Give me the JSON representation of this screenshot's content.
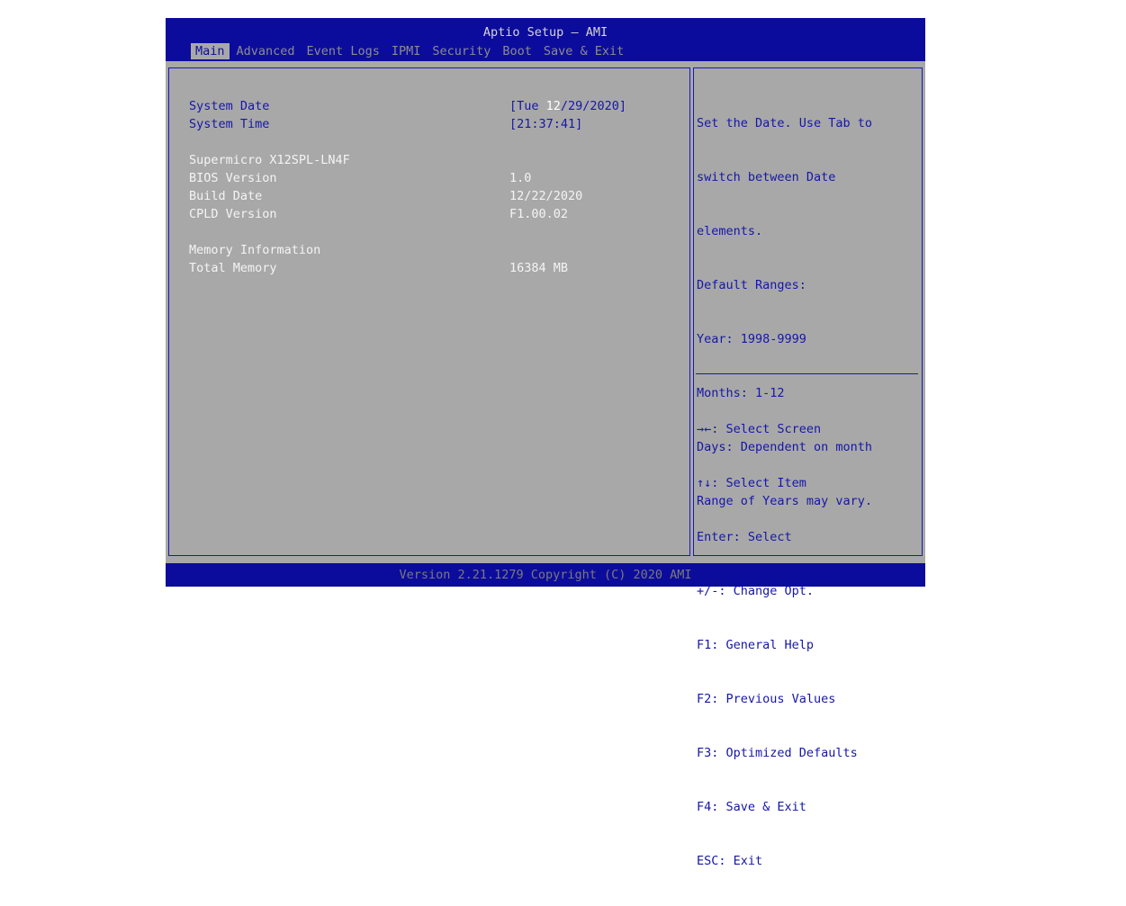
{
  "header": {
    "title": "Aptio Setup – AMI"
  },
  "tabs": [
    "Main",
    "Advanced",
    "Event Logs",
    "IPMI",
    "Security",
    "Boot",
    "Save & Exit"
  ],
  "active_tab": "Main",
  "main": {
    "system_date_label": "System Date",
    "system_date_open": "[Tue ",
    "system_date_month": "12",
    "system_date_rest": "/29/2020]",
    "system_time_label": "System Time",
    "system_time_value": "[21:37:41]",
    "board_name": "Supermicro X12SPL-LN4F",
    "bios_version_label": "BIOS Version",
    "bios_version_value": "1.0",
    "build_date_label": "Build Date",
    "build_date_value": "12/22/2020",
    "cpld_version_label": "CPLD Version",
    "cpld_version_value": "F1.00.02",
    "memory_info_label": "Memory Information",
    "total_memory_label": "Total Memory",
    "total_memory_value": "16384 MB"
  },
  "help": {
    "lines": [
      "Set the Date. Use Tab to",
      "switch between Date",
      "elements.",
      "Default Ranges:",
      "Year: 1998-9999",
      "Months: 1-12",
      "Days: Dependent on month",
      "Range of Years may vary."
    ]
  },
  "keys": {
    "lines": [
      "→←: Select Screen",
      "↑↓: Select Item",
      "Enter: Select",
      "+/-: Change Opt.",
      "F1: General Help",
      "F2: Previous Values",
      "F3: Optimized Defaults",
      "F4: Save & Exit",
      "ESC: Exit"
    ]
  },
  "footer": {
    "version": "Version 2.21.1279 Copyright (C) 2020 AMI"
  },
  "colors": {
    "header_blue": "#0c0c9c",
    "panel_gray": "#a8a8a8",
    "link_blue": "#1616aa",
    "text_white": "#f4f4f4"
  }
}
